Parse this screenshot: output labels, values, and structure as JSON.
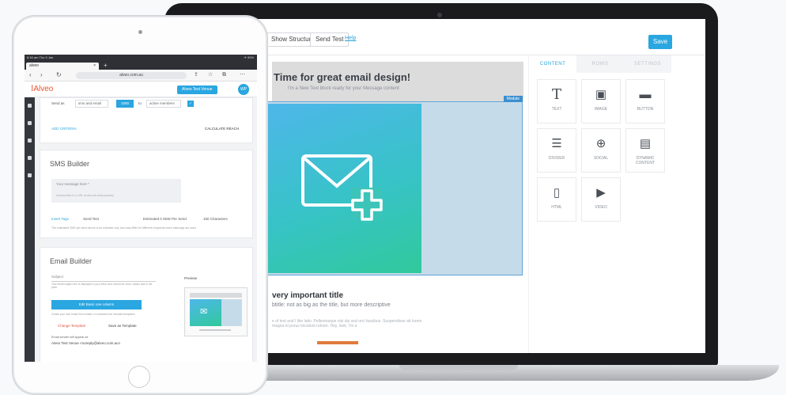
{
  "laptop": {
    "toolbar": {
      "structure_label": "Show Structure",
      "send_test_label": "Send Test",
      "help_label": "Help",
      "save_label": "Save"
    },
    "canvas": {
      "hero_title": "Time for great email design!",
      "hero_subtitle": "I'm a New Text block ready for your Message content",
      "module_tag": "Module",
      "title": "very important title",
      "subtitle": "btitle: not as big as the title, but more descriptive",
      "body": "e of text and I like latin. Pellentesque nisi dui sed orci faucibus. Suspendisse ab lorem magna et purus tincidunt rutrum. Hey, look, I'm a"
    },
    "panel": {
      "tabs": [
        "CONTENT",
        "ROWS",
        "SETTINGS"
      ],
      "blocks": [
        {
          "label": "TEXT",
          "icon": "T"
        },
        {
          "label": "IMAGE",
          "icon": "▣"
        },
        {
          "label": "BUTTON",
          "icon": "▬"
        },
        {
          "label": "DIVIDER",
          "icon": "☰"
        },
        {
          "label": "SOCIAL",
          "icon": "⊕"
        },
        {
          "label": "DYNAMIC CONTENT",
          "icon": "▤"
        },
        {
          "label": "HTML",
          "icon": "▯"
        },
        {
          "label": "VIDEO",
          "icon": "▶"
        }
      ]
    }
  },
  "tablet": {
    "status_time": "8:16 am Thu 9 Jan",
    "status_right": "✈ 90%",
    "tab_title": "alveo",
    "url": "alveo.com.au",
    "logo_text": "Alveo",
    "user_menu": "Alveo Test Venue",
    "avatar_text": "WP",
    "criteria": {
      "send_as": "Send as",
      "channel": "sms and email",
      "count": "1000",
      "to": "to",
      "audience": "active members",
      "add_criteria": "ADD CRITERIA",
      "calculate": "CALCULATE REACH"
    },
    "sms": {
      "title": "SMS Builder",
      "message_placeholder": "Your message here *",
      "message_hint": "Unsubscribe in a URL sends ask are/purposely",
      "insert_tags": "Insert Tags",
      "send_test": "Send Test",
      "estimate": "Estimated 0 SMS Per Send",
      "chars": "160 Characters",
      "note": "The estimated SMS per send above is an estimate only and may differ for different recipients when data tags are used"
    },
    "email": {
      "title": "Email Builder",
      "subject_label": "Subject",
      "subject_hint": "Your email subject line is displayed in your inbox and should be short, catchy and to the point",
      "edit_button": "Edit Basic one column",
      "create_hint": "Create your own email from scratch or customise the included templates",
      "change_template": "Change Template",
      "save_template": "Save as Template",
      "sender_label": "Email sender will appear as",
      "sender_value": "Alveo Test Venue <noreply@alveo.com.au>",
      "preview_label": "Preview"
    }
  }
}
